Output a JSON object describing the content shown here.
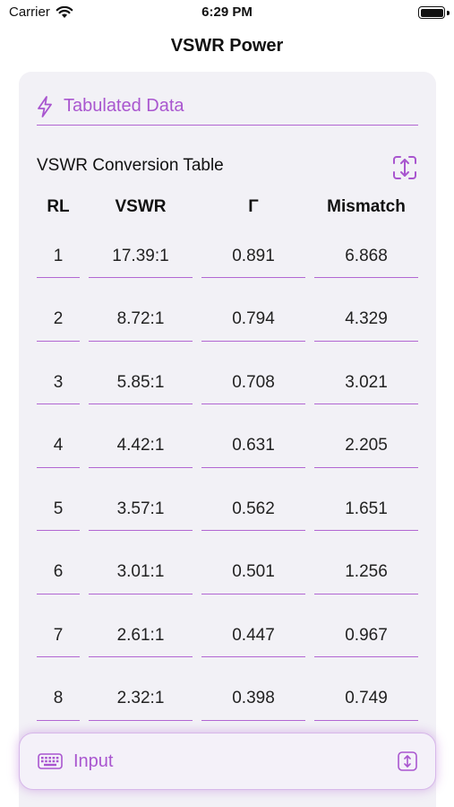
{
  "status": {
    "carrier": "Carrier",
    "time": "6:29 PM"
  },
  "nav": {
    "title": "VSWR Power"
  },
  "section": {
    "title": "Tabulated Data",
    "icon": "lightning-icon"
  },
  "table": {
    "caption": "VSWR Conversion Table",
    "headers": [
      "RL",
      "VSWR",
      "Γ",
      "Mismatch"
    ],
    "rows": [
      [
        "1",
        "17.39:1",
        "0.891",
        "6.868"
      ],
      [
        "2",
        "8.72:1",
        "0.794",
        "4.329"
      ],
      [
        "3",
        "5.85:1",
        "0.708",
        "3.021"
      ],
      [
        "4",
        "4.42:1",
        "0.631",
        "2.205"
      ],
      [
        "5",
        "3.57:1",
        "0.562",
        "1.651"
      ],
      [
        "6",
        "3.01:1",
        "0.501",
        "1.256"
      ],
      [
        "7",
        "2.61:1",
        "0.447",
        "0.967"
      ],
      [
        "8",
        "2.32:1",
        "0.398",
        "0.749"
      ]
    ]
  },
  "input_bar": {
    "label": "Input",
    "icon": "keyboard-icon",
    "action_icon": "resize-vertical-icon"
  },
  "colors": {
    "accent": "#a956cf",
    "card": "#f2f1f6"
  }
}
